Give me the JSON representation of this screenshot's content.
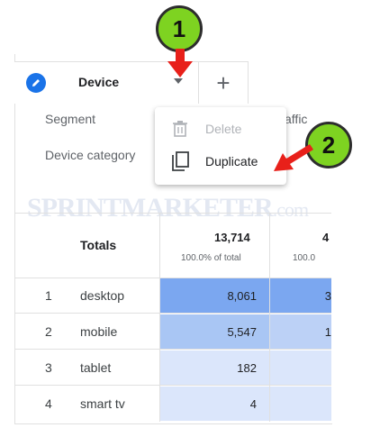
{
  "tabs": {
    "active_label": "Device",
    "add_label": "+"
  },
  "table": {
    "row_labels_header": [
      "Segment",
      "Device category"
    ],
    "col2_header_fragment": "affic",
    "totals_label": "Totals",
    "totals": [
      {
        "value": "13,714",
        "sub": "100.0% of total"
      },
      {
        "value": "4",
        "sub": "100.0"
      }
    ],
    "rows": [
      {
        "num": "1",
        "name": "desktop",
        "v1": "8,061",
        "v2": "3"
      },
      {
        "num": "2",
        "name": "mobile",
        "v1": "5,547",
        "v2": "1"
      },
      {
        "num": "3",
        "name": "tablet",
        "v1": "182",
        "v2": ""
      },
      {
        "num": "4",
        "name": "smart tv",
        "v1": "4",
        "v2": ""
      }
    ],
    "bar_colors": {
      "strong": "#7ba7f0",
      "medium": "#a9c6f4",
      "light": "#dbe6fb"
    }
  },
  "menu": {
    "items": [
      {
        "label": "Delete",
        "icon": "trash-icon",
        "enabled": false
      },
      {
        "label": "Duplicate",
        "icon": "copy-icon",
        "enabled": true
      }
    ]
  },
  "annotations": {
    "badge1": "1",
    "badge2": "2",
    "badge_color": "#7ed321",
    "arrow_color": "#e8201a"
  },
  "watermark": {
    "text": "SPRINTMARKETER",
    "suffix": ".com"
  }
}
